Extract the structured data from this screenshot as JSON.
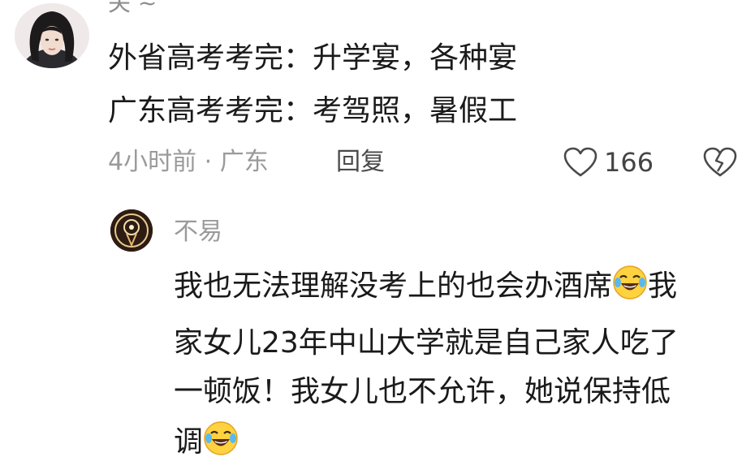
{
  "comment": {
    "username": "关 ~",
    "lines": [
      "外省高考考完：升学宴，各种宴",
      "广东高考考完：考驾照，暑假工"
    ],
    "meta": "4小时前 · 广东",
    "reply_label": "回复",
    "like_count": "166",
    "icons": {
      "like": "heart-outline-icon",
      "dislike": "broken-heart-icon"
    }
  },
  "reply": {
    "username": "不易",
    "lines": [
      "我也无法理解没考上的也会办酒席",
      "我",
      "家女儿23年中山大学就是自己家人吃了",
      "一顿饭！我女儿也不允许，她说保持低",
      "调"
    ],
    "emoji": "laughing-crying-emoji"
  },
  "colors": {
    "text": "#1a1a1a",
    "meta": "#9a9a9a",
    "emoji_face": "#ffd23f"
  }
}
